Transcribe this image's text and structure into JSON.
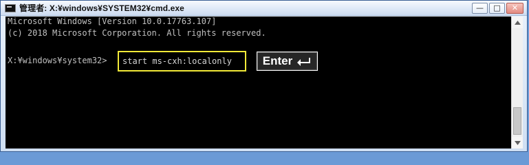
{
  "window": {
    "title": "管理者: X:¥windows¥SYSTEM32¥cmd.exe",
    "icon": "console-app-icon",
    "controls": {
      "minimize": "minimize-icon",
      "maximize": "maximize-icon",
      "close": "close-icon"
    }
  },
  "console": {
    "line1": "Microsoft Windows [Version 10.0.17763.107]",
    "line2": "(c) 2018 Microsoft Corporation. All rights reserved.",
    "prompt": "X:¥windows¥system32>",
    "command": "start ms-cxh:localonly",
    "enter_label": "Enter",
    "highlight_color": "#f3ea38",
    "background_color": "#000000",
    "text_color": "#c0c0c0"
  },
  "scrollbar": {
    "up_icon": "scroll-up-arrow-icon",
    "down_icon": "scroll-down-arrow-icon"
  }
}
